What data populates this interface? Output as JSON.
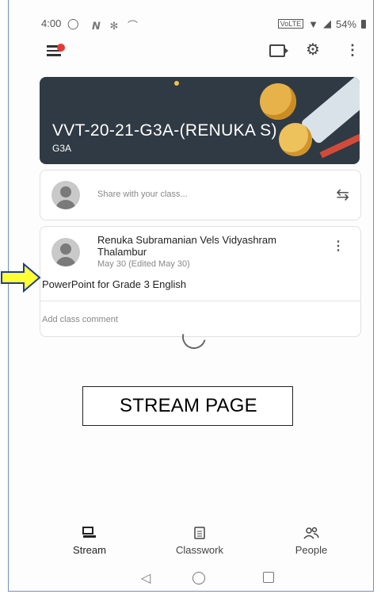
{
  "status_bar": {
    "time": "4:00",
    "notification_icons": "𝙉 ✻ ⌒",
    "battery": "54%"
  },
  "banner": {
    "title": "VVT-20-21-G3A-(RENUKA S)",
    "section": "G3A"
  },
  "share": {
    "placeholder": "Share with your class..."
  },
  "post": {
    "author": "Renuka Subramanian Vels Vidyashram Thalambur",
    "date": "May 30 (Edited May 30)",
    "body": "PowerPoint for Grade 3 English",
    "comment_placeholder": "Add class comment"
  },
  "caption": "STREAM PAGE",
  "bottom_nav": [
    {
      "label": "Stream",
      "icon": "stream-icon"
    },
    {
      "label": "Classwork",
      "icon": "classwork-icon"
    },
    {
      "label": "People",
      "icon": "people-icon"
    }
  ],
  "colors": {
    "banner_bg": "#2f3a44",
    "notification_dot": "#e53935",
    "arrow_fill": "#ffff33",
    "arrow_stroke": "#1f3a93"
  }
}
